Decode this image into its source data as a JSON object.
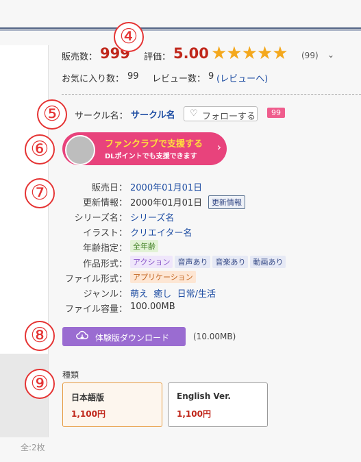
{
  "sales": {
    "label": "販売数：",
    "value": "999"
  },
  "rating": {
    "label": "評価：",
    "value": "5.00",
    "stars": "★★★★★",
    "count": "(99)"
  },
  "favorites": {
    "label": "お気に入り数：",
    "value": "99"
  },
  "reviews": {
    "label": "レビュー数：",
    "value": "9",
    "link": "(レビューへ)"
  },
  "circle": {
    "label": "サークル名：",
    "name": "サークル名",
    "follow_label": "フォローする",
    "follower_count": "99"
  },
  "fanclub": {
    "title": "ファンクラブで支援する",
    "subtitle": "DLポイントでも支援できます"
  },
  "info": {
    "release": {
      "label": "販売日：",
      "value": "2000年01月01日"
    },
    "update": {
      "label": "更新情報：",
      "value": "2000年01月01日",
      "button": "更新情報"
    },
    "series": {
      "label": "シリーズ名：",
      "value": "シリーズ名"
    },
    "illust": {
      "label": "イラスト：",
      "value": "クリエイター名"
    },
    "age": {
      "label": "年齢指定：",
      "value": "全年齢"
    },
    "work_format": {
      "label": "作品形式：",
      "tags": [
        "アクション",
        "音声あり",
        "音楽あり",
        "動画あり"
      ]
    },
    "file_format": {
      "label": "ファイル形式：",
      "value": "アプリケーション"
    },
    "genre": {
      "label": "ジャンル：",
      "tags": [
        "萌え",
        "癒し",
        "日常/生活"
      ]
    },
    "file_size": {
      "label": "ファイル容量：",
      "value": "100.00MB"
    }
  },
  "trial": {
    "button": "体験版ダウンロード",
    "size": "(10.00MB)"
  },
  "variants": {
    "label": "種類",
    "items": [
      {
        "name": "日本語版",
        "price": "1,100円"
      },
      {
        "name": "English Ver.",
        "price": "1,100円"
      }
    ]
  },
  "markers": [
    "④",
    "⑤",
    "⑥",
    "⑦",
    "⑧",
    "⑨"
  ],
  "page_count": "全:2枚",
  "colors": {
    "accent_red": "#c0271b",
    "star": "#f4a81d",
    "fanclub": "#e8437c",
    "download": "#9a6cd1",
    "link": "#1f4ea3"
  }
}
